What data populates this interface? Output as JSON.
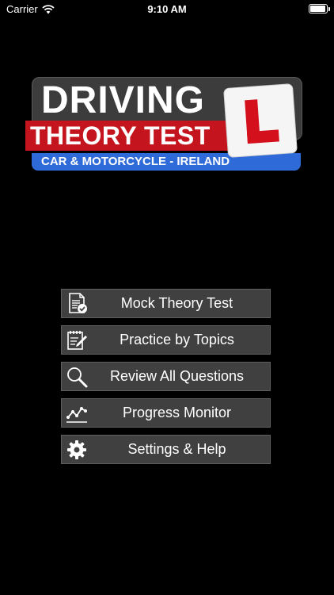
{
  "status_bar": {
    "carrier": "Carrier",
    "time": "9:10 AM",
    "battery_level": 0.95
  },
  "logo": {
    "line1": "DRIVING",
    "line2": "THEORY TEST",
    "line3": "CAR & MOTORCYCLE - IRELAND",
    "plate_letter": "L",
    "colors": {
      "red": "#c4141e",
      "blue": "#2f6bd8",
      "dark": "#3c3c3c"
    }
  },
  "menu": {
    "items": [
      {
        "label": "Mock Theory Test",
        "icon": "test-checklist-icon"
      },
      {
        "label": "Practice by Topics",
        "icon": "notepad-pencil-icon"
      },
      {
        "label": "Review All Questions",
        "icon": "magnifier-icon"
      },
      {
        "label": "Progress Monitor",
        "icon": "line-graph-icon"
      },
      {
        "label": "Settings & Help",
        "icon": "gear-icon"
      }
    ]
  }
}
